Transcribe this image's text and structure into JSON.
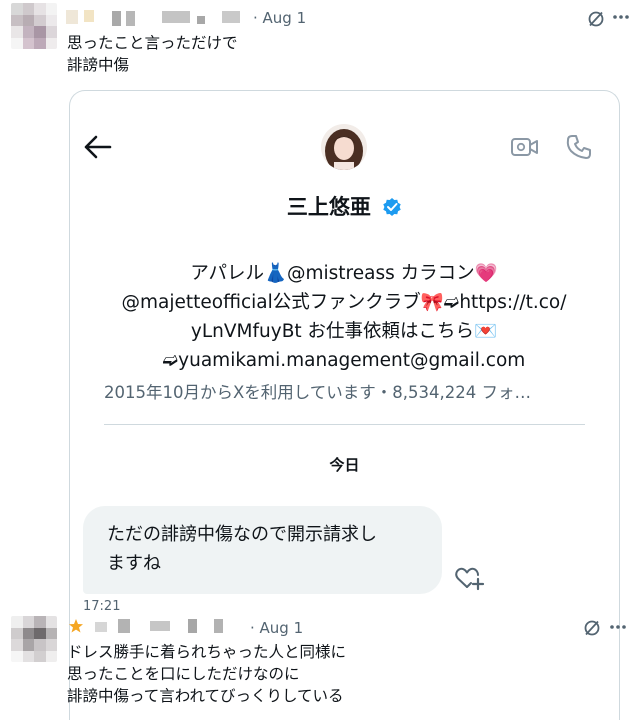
{
  "reply1": {
    "date": "· Aug 1",
    "text": "思ったこと言っただけで\n誹謗中傷"
  },
  "dm": {
    "header": {
      "name": "三上悠亜"
    },
    "bio": {
      "line1": "アパレル👗@mistreass カラコン💗",
      "line2": "@majetteofficial公式ファンクラブ🎀➫https://t.co/",
      "line3": "yLnVMfuyBt お仕事依頼はこちら💌",
      "line4": "➫yuamikami.management@gmail.com"
    },
    "joined": "2015年10月からXを利用しています・8,534,224 フォ…",
    "today": "今日",
    "message": "ただの誹謗中傷なので開示請求し\nますね",
    "time": "17:21"
  },
  "reply2": {
    "date": "· Aug 1",
    "text": "ドレス勝手に着られちゃった人と同様に\n思ったことを口にしただけなのに\n誹謗中傷って言われてびっくりしている"
  },
  "colors": {
    "accent": "#1d9bf0",
    "secondary_text": "#536471",
    "bubble": "#eff3f4",
    "border": "#cfd9de"
  }
}
